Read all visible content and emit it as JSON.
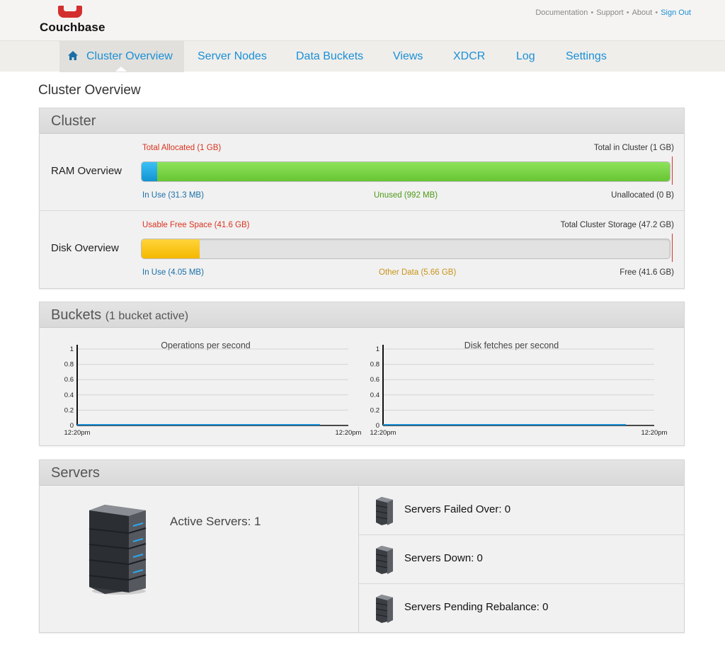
{
  "brand": {
    "name": "Couchbase"
  },
  "toplinks": {
    "documentation": "Documentation",
    "support": "Support",
    "about": "About",
    "sign_out": "Sign Out"
  },
  "nav": {
    "items": [
      {
        "label": "Cluster Overview"
      },
      {
        "label": "Server Nodes"
      },
      {
        "label": "Data Buckets"
      },
      {
        "label": "Views"
      },
      {
        "label": "XDCR"
      },
      {
        "label": "Log"
      },
      {
        "label": "Settings"
      }
    ],
    "active": "Cluster Overview"
  },
  "page_title": "Cluster Overview",
  "cluster": {
    "title": "Cluster",
    "ram": {
      "label": "RAM Overview",
      "top_left": "Total Allocated (1 GB)",
      "top_right": "Total in Cluster (1 GB)",
      "bottom_left": "In Use (31.3 MB)",
      "bottom_mid": "Unused (992 MB)",
      "bottom_right": "Unallocated (0 B)",
      "in_use_fraction": 0.03,
      "unused_fraction": 0.97
    },
    "disk": {
      "label": "Disk Overview",
      "top_left": "Usable Free Space (41.6 GB)",
      "top_right": "Total Cluster Storage (47.2 GB)",
      "bottom_left": "In Use (4.05 MB)",
      "bottom_mid": "Other Data (5.66 GB)",
      "bottom_right": "Free (41.6 GB)",
      "used_fraction": 0.11
    },
    "colors": {
      "in_use": "#1aa3e0",
      "unused": "#7bd445",
      "other_data": "#ffc20e",
      "marker": "#d9331f"
    }
  },
  "buckets": {
    "title": "Buckets",
    "subtitle": "(1 bucket active)",
    "charts": [
      {
        "title": "Operations per second",
        "yticks": [
          "0",
          "0.2",
          "0.4",
          "0.6",
          "0.8",
          "1"
        ],
        "x_start": "12:20pm",
        "x_end": "12:20pm"
      },
      {
        "title": "Disk fetches per second",
        "yticks": [
          "0",
          "0.2",
          "0.4",
          "0.6",
          "0.8",
          "1"
        ],
        "x_start": "12:20pm",
        "x_end": "12:20pm"
      }
    ]
  },
  "chart_data": [
    {
      "type": "line",
      "title": "Operations per second",
      "x": [
        "12:20pm",
        "12:20pm"
      ],
      "series": [
        {
          "values": [
            0,
            0
          ]
        }
      ],
      "ylim": [
        0,
        1
      ],
      "grid": true
    },
    {
      "type": "line",
      "title": "Disk fetches per second",
      "x": [
        "12:20pm",
        "12:20pm"
      ],
      "series": [
        {
          "values": [
            0,
            0
          ]
        }
      ],
      "ylim": [
        0,
        1
      ],
      "grid": true
    }
  ],
  "servers": {
    "title": "Servers",
    "active": "Active Servers: 1",
    "failed_over": "Servers Failed Over: 0",
    "down": "Servers Down: 0",
    "pending": "Servers Pending Rebalance: 0"
  }
}
